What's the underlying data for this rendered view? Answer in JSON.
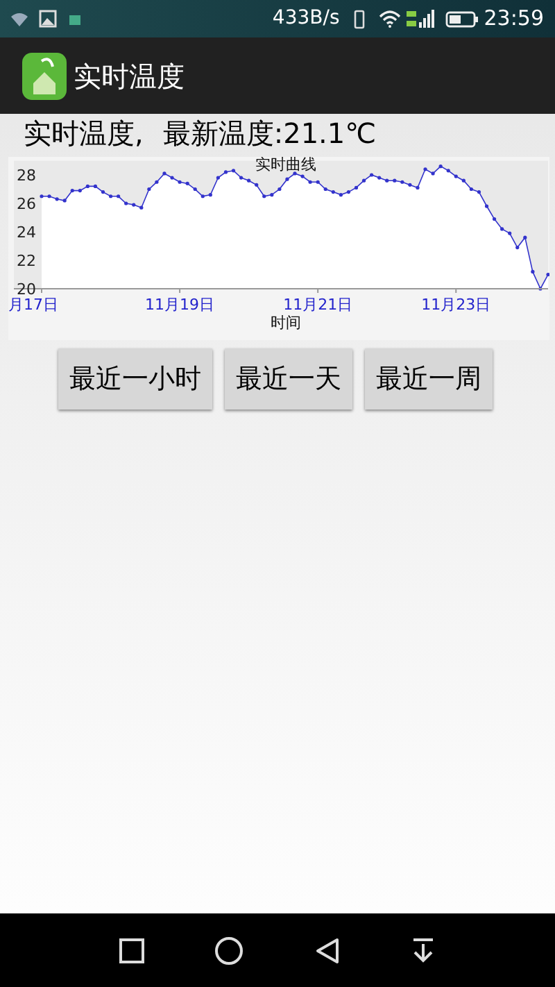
{
  "status_bar": {
    "net_speed": "433B/s",
    "time": "23:59"
  },
  "app_bar": {
    "title": "实时温度"
  },
  "header": {
    "label": "实时温度,",
    "latest": "最新温度:21.1℃"
  },
  "chart": {
    "chart_data": {
      "type": "area",
      "title": "实时曲线",
      "xlabel": "时间",
      "ylim": [
        20,
        29
      ],
      "yticks": [
        20,
        22,
        24,
        26,
        28
      ],
      "categories": [
        "月17日",
        null,
        null,
        null,
        null,
        null,
        null,
        null,
        null,
        null,
        null,
        null,
        null,
        null,
        null,
        null,
        null,
        null,
        "11月19日",
        null,
        null,
        null,
        null,
        null,
        null,
        null,
        null,
        null,
        null,
        null,
        null,
        null,
        null,
        null,
        null,
        null,
        "11月21日",
        null,
        null,
        null,
        null,
        null,
        null,
        null,
        null,
        null,
        null,
        null,
        null,
        null,
        null,
        null,
        null,
        null,
        "11月23日",
        null,
        null,
        null,
        null,
        null,
        null,
        null,
        null,
        null,
        null,
        null,
        null
      ],
      "series": [
        {
          "color": "#3333cc",
          "values": [
            26.5,
            26.5,
            26.3,
            26.2,
            26.9,
            26.9,
            27.2,
            27.2,
            26.8,
            26.5,
            26.5,
            26.0,
            25.9,
            25.7,
            27.0,
            27.5,
            28.1,
            27.8,
            27.5,
            27.4,
            27.0,
            26.5,
            26.6,
            27.8,
            28.2,
            28.3,
            27.8,
            27.6,
            27.3,
            26.5,
            26.6,
            27.0,
            27.7,
            28.1,
            27.9,
            27.5,
            27.5,
            27.0,
            26.8,
            26.6,
            26.8,
            27.1,
            27.6,
            28.0,
            27.8,
            27.6,
            27.6,
            27.5,
            27.3,
            27.1,
            28.4,
            28.1,
            28.6,
            28.3,
            27.9,
            27.6,
            27.0,
            26.8,
            25.8,
            24.9,
            24.2,
            23.9,
            22.9,
            23.6,
            21.2,
            20.0,
            21.0
          ]
        }
      ]
    }
  },
  "buttons": [
    "最近一小时",
    "最近一天",
    "最近一周"
  ]
}
